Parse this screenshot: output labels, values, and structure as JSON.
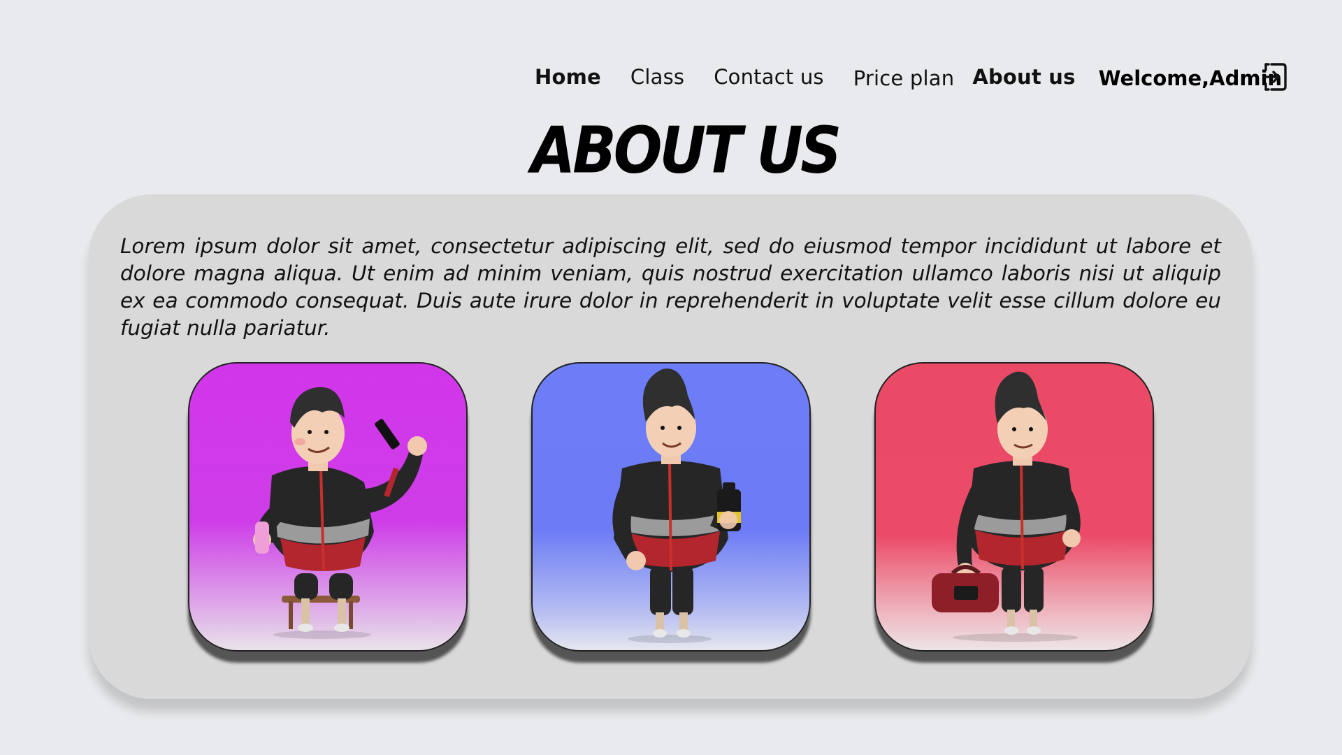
{
  "nav": {
    "items": [
      {
        "label": "Home"
      },
      {
        "label": "Class"
      },
      {
        "label": "Contact us"
      },
      {
        "label": "Price plan"
      },
      {
        "label": "About us"
      }
    ],
    "welcome": "Welcome,Admin",
    "logout_icon": "logout-icon"
  },
  "page": {
    "title": "ABOUT US",
    "description": "Lorem ipsum dolor sit amet, consectetur adipiscing elit, sed do eiusmod tempor incididunt ut labore et dolore magna aliqua.  Ut enim ad minim veniam, quis nostrud exercitation ullamco  laboris nisi ut aliquip ex ea commodo consequat. Duis aute irure dolor in reprehenderit in voluptate velit esse cillum dolore eu fugiat nulla pariatur."
  },
  "tiles": [
    {
      "name": "selfie-character",
      "color": "#d236ea",
      "icon": "person-selfie-illustration"
    },
    {
      "name": "shaker-character",
      "color": "#6d7df8",
      "icon": "person-shaker-illustration"
    },
    {
      "name": "gym-bag-character",
      "color": "#ea4a66",
      "icon": "person-gym-bag-illustration"
    }
  ]
}
